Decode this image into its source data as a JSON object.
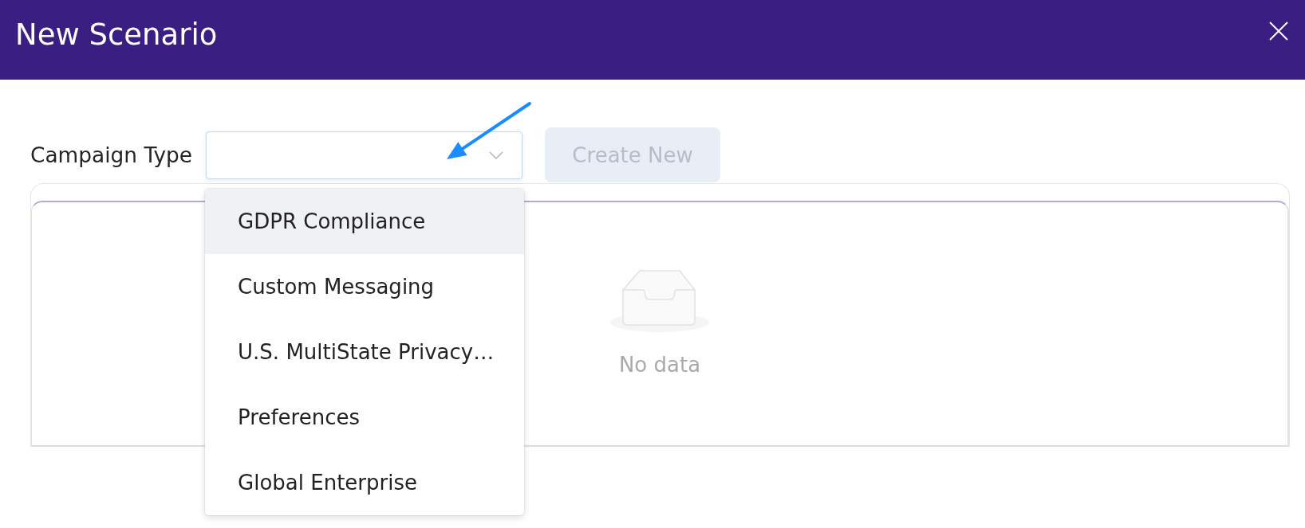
{
  "dialog": {
    "title": "New Scenario"
  },
  "form": {
    "label": "Campaign Type",
    "select": {
      "expanded": true,
      "options": [
        {
          "label": "GDPR Compliance",
          "selected": true
        },
        {
          "label": "Custom Messaging",
          "selected": false
        },
        {
          "label": "U.S. MultiState Privacy…",
          "selected": false
        },
        {
          "label": "Preferences",
          "selected": false
        },
        {
          "label": "Global Enterprise",
          "selected": false
        }
      ]
    },
    "create_button": {
      "label": "Create New",
      "disabled": true
    }
  },
  "table": {
    "empty_text": "No data"
  }
}
